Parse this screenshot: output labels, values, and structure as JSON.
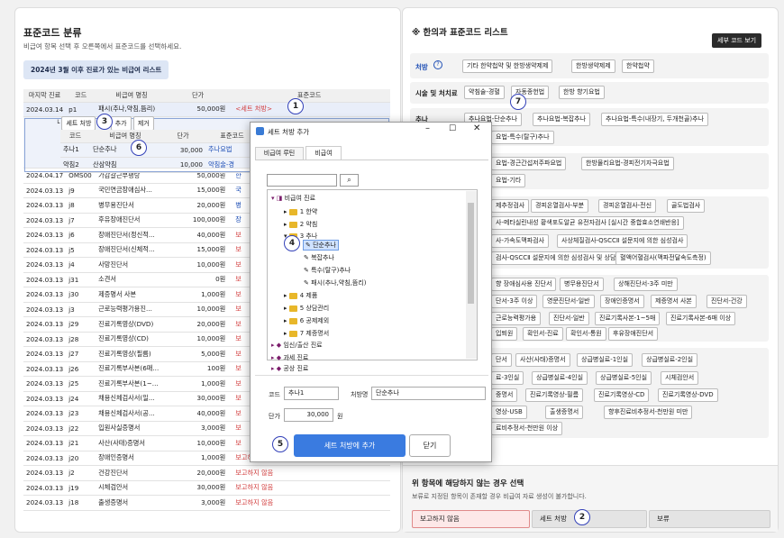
{
  "left": {
    "title": "표준코드 분류",
    "subtitle": "비급여 항목 선택 후 오른쪽에서 표준코드를 선택하세요.",
    "filter": "2024년 3월 이후 진료가 있는 비급여 리스트",
    "headers": [
      "마지막 진료",
      "코드",
      "비급여 명칭",
      "단가",
      "표준코드"
    ],
    "first": {
      "date": "2024.03.14",
      "code": "p1",
      "name": "패시(추나,약침,뜸리)",
      "price": "50,000원",
      "std": "<세트 처방>"
    },
    "set_label": "세트 처방",
    "add": "추가",
    "remove": "제거",
    "sub_headers": [
      "코드",
      "비급여 명칭",
      "단가",
      "표준코드"
    ],
    "sub_rows": [
      [
        "추나1",
        "단순추나",
        "30,000",
        "추나요법"
      ],
      [
        "약침2",
        "산삼약침",
        "10,000",
        "약침술-경"
      ]
    ],
    "rows": [
      [
        "2024.04.17",
        "OMS00",
        "가감갈근부평탕",
        "50,000원",
        "한"
      ],
      [
        "2024.03.13",
        "j9",
        "국민연금장애심사...",
        "15,000원",
        "국"
      ],
      [
        "2024.03.13",
        "j8",
        "병무용진단서",
        "20,000원",
        "병"
      ],
      [
        "2024.03.13",
        "j7",
        "후유장애진단서",
        "100,000원",
        "장"
      ],
      [
        "2024.03.13",
        "j6",
        "장애진단서(정신적...",
        "40,000원",
        "보"
      ],
      [
        "2024.03.13",
        "j5",
        "장애진단서(신체적...",
        "15,000원",
        "보"
      ],
      [
        "2024.03.13",
        "j4",
        "사망진단서",
        "10,000원",
        "보"
      ],
      [
        "2024.03.13",
        "j31",
        "소견서",
        "0원",
        "보"
      ],
      [
        "2024.03.13",
        "j30",
        "제증명서 사본",
        "1,000원",
        "보"
      ],
      [
        "2024.03.13",
        "j3",
        "근로능력평가용진...",
        "10,000원",
        "보"
      ],
      [
        "2024.03.13",
        "j29",
        "진료기록영상(DVD)",
        "20,000원",
        "보"
      ],
      [
        "2024.03.13",
        "j28",
        "진료기록영상(CD)",
        "10,000원",
        "보"
      ],
      [
        "2024.03.13",
        "j27",
        "진료기록영상(필름)",
        "5,000원",
        "보"
      ],
      [
        "2024.03.13",
        "j26",
        "진료기록부사본(6매...",
        "100원",
        "보"
      ],
      [
        "2024.03.13",
        "j25",
        "진료기록부사본(1~...",
        "1,000원",
        "보"
      ],
      [
        "2024.03.13",
        "j24",
        "채용신체검사서(일...",
        "30,000원",
        "보"
      ],
      [
        "2024.03.13",
        "j23",
        "채용신체검사서(공...",
        "40,000원",
        "보"
      ],
      [
        "2024.03.13",
        "j22",
        "입원사실증명서",
        "3,000원",
        "보"
      ],
      [
        "2024.03.13",
        "j21",
        "사산(사태)증명서",
        "10,000원",
        "보"
      ],
      [
        "2024.03.13",
        "j20",
        "장애인증명서",
        "1,000원",
        "보고하지 않음"
      ],
      [
        "2024.03.13",
        "j2",
        "건강진단서",
        "20,000원",
        "보고하지 않음"
      ],
      [
        "2024.03.13",
        "j19",
        "시체검안서",
        "30,000원",
        "보고하지 않음"
      ],
      [
        "2024.03.13",
        "j18",
        "출생증명서",
        "3,000원",
        "보고하지 않음"
      ]
    ]
  },
  "right": {
    "title": "※ 한의과 표준코드 리스트",
    "detail_btn": "세부 코드 보기",
    "g1_label": "처방",
    "g1_tags": [
      "기타 한약첩약 및 한방생약제제",
      "한방생약제제",
      "한약첩약"
    ],
    "g2_label": "시술 및 처치료",
    "g2_tags": [
      "약침술-경혈",
      "자동종헌법",
      "한방 향기요법"
    ],
    "g3_label": "추나",
    "g3_tags": [
      "추나요법-단순추나",
      "추나요법-복잡추나",
      "추나요법-특수(내장기, 두개천골)추나",
      "요법-특수(탈구)추나"
    ],
    "g4_tags": [
      "요법-경근간섭저주파요법",
      "한방물리요법-경피전기자극요법",
      "요법-기타"
    ],
    "g5_tags": [
      "제추정검사",
      "경피온열검사-부분",
      "경피온열검사-전신",
      "골도법검사",
      "사-메타실린내성 황색포도알균 유전자검사 [실시간 중합효소연쇄반응]",
      "사-가속도맥파검사",
      "사상체질검사-QSCCⅡ 설문지에 의한 심성검사",
      "검사-QSCCⅡ 설문지에 의한 심성검사 및 상담",
      "혈액어혈검사(맥파전달속도측정)"
    ],
    "g6_tags": [
      "향 장애심사용 진단서",
      "병무용진단서",
      "상해진단서-3주 미만",
      "단서-3주 이상",
      "영문진단서-일반",
      "장애인증명서",
      "제증명서 사본",
      "진단서-건강",
      "근로능력평가용",
      "진단서-일반",
      "진료기록사본-1~5매",
      "진료기록사본-6매 이상",
      "입퇴원",
      "확인서-진료",
      "확인서-통원",
      "후유장애진단서"
    ],
    "g7_tags": [
      "단서",
      "사산(사태)증명서",
      "상급병실료-1인실",
      "상급병실료-2인실",
      "료-3인실",
      "상급병실료-4인실",
      "상급병실료-5인실",
      "시체검안서",
      "중명서",
      "진료기록영상-필름",
      "진료기록영상-CD",
      "진료기록영상-DVD",
      "영상-USB",
      "출생증명서",
      "향후진료비추정서-천만원 미만",
      "료비추정서-천만원 이상"
    ],
    "none_title": "위 항목에 해당하지 않는 경우 선택",
    "none_sub": "보류로 지정된 항목이 존재할 경우 비급여 자료 생성이 불가합니다.",
    "opt_none": "보고하지 않음",
    "opt_set": "세트 처방",
    "opt_hold": "보류"
  },
  "dialog": {
    "title": "세트 처방 추가",
    "tab1": "비급여 루틴",
    "tab2": "비급여",
    "tree": [
      "비급여 진료",
      "1 한약",
      "2 약침",
      "3 추나",
      "단순추나",
      "복잡추나",
      "특수(탈구)추나",
      "패시(추나,약침,뜸리)",
      "4 제품",
      "5 상담관리",
      "6 공제제외",
      "7 제증명서",
      "임신/출산 진료",
      "과세 진료",
      "공상 진료"
    ],
    "code_label": "코드",
    "code_value": "추나1",
    "name_label": "처방명",
    "name_value": "단순추나",
    "price_label": "단가",
    "price_value": "30,000",
    "price_unit": "원",
    "add_btn": "세트 처방에 추가",
    "close_btn": "닫기"
  },
  "markers": [
    "1",
    "2",
    "3",
    "4",
    "5",
    "6",
    "7"
  ]
}
